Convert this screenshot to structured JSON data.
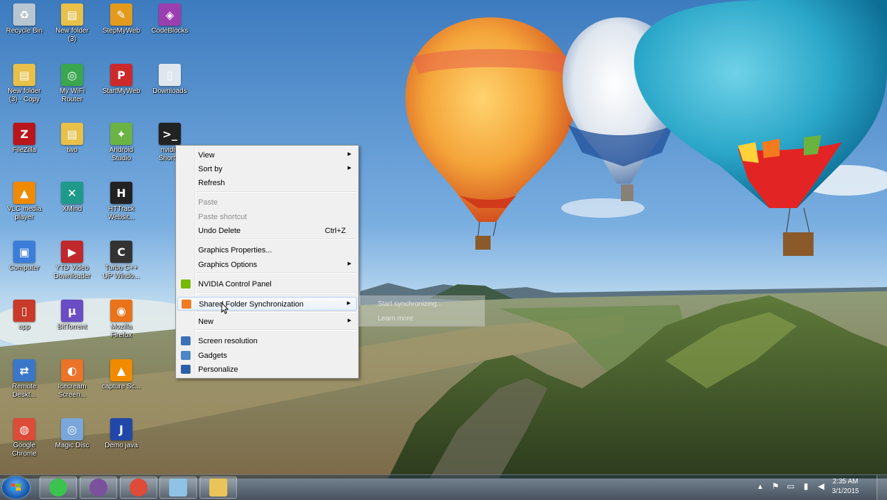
{
  "desktop": {
    "icons": [
      {
        "label": "Recycle Bin",
        "icon": "recycle-bin-icon",
        "color": "#b8c6d2"
      },
      {
        "label": "New folder\n(3)",
        "icon": "folder-icon",
        "color": "#e8c04a"
      },
      {
        "label": "StepMyWeb",
        "icon": "stepmyweb-icon",
        "color": "#e39b1e"
      },
      {
        "label": "CodeBlocks",
        "icon": "codeblocks-icon",
        "color": "#9b3fb0"
      },
      {
        "label": "New folder\n(3) - Copy",
        "icon": "folder-icon",
        "color": "#e8c04a"
      },
      {
        "label": "My WiFi\nRouter",
        "icon": "wifi-router-icon",
        "color": "#3aa650"
      },
      {
        "label": "StartMyWeb",
        "icon": "pinterest-icon",
        "color": "#cc2a2a"
      },
      {
        "label": "Downloads",
        "icon": "document-icon",
        "color": "#dfe6ee"
      },
      {
        "label": "FileZilla",
        "icon": "filezilla-icon",
        "color": "#b8161c"
      },
      {
        "label": "two",
        "icon": "folder-icon",
        "color": "#e8c04a"
      },
      {
        "label": "Android\nStudio",
        "icon": "android-studio-icon",
        "color": "#6ab344"
      },
      {
        "label": "nvidia\nShort...",
        "icon": "terminal-icon",
        "color": "#222222"
      },
      {
        "label": "VLC media\nplayer",
        "icon": "vlc-icon",
        "color": "#f08a00"
      },
      {
        "label": "XMind",
        "icon": "xmind-icon",
        "color": "#1f9a8a"
      },
      {
        "label": "HTTrack\nWebsit...",
        "icon": "httrack-icon",
        "color": "#222222"
      },
      {
        "label": "Computer",
        "icon": "computer-icon",
        "color": "#3b7dd8"
      },
      {
        "label": "YTD Video\nDownloader",
        "icon": "ytd-icon",
        "color": "#c0282d"
      },
      {
        "label": "Turbo C++\nUP Windo...",
        "icon": "turbo-cpp-icon",
        "color": "#333333"
      },
      {
        "label": "app",
        "icon": "document-icon",
        "color": "#c83a2a"
      },
      {
        "label": "BitTorrent",
        "icon": "bittorrent-icon",
        "color": "#6a4cc4"
      },
      {
        "label": "Mozilla\nFirefox",
        "icon": "firefox-icon",
        "color": "#e8731a"
      },
      {
        "label": "Remote\nDeskt...",
        "icon": "remote-desktop-icon",
        "color": "#3a77c9"
      },
      {
        "label": "Icecream\nScreen...",
        "icon": "icecream-icon",
        "color": "#e9742a"
      },
      {
        "label": "capture Sc...",
        "icon": "vlc-icon",
        "color": "#f08a00"
      },
      {
        "label": "Google\nChrome",
        "icon": "chrome-icon",
        "color": "#dd4b39"
      },
      {
        "label": "Magic Disc",
        "icon": "disc-icon",
        "color": "#7aa7d9"
      },
      {
        "label": "Demo java",
        "icon": "java-file-icon",
        "color": "#2148a8"
      }
    ]
  },
  "context_menu": {
    "items": [
      {
        "label": "View",
        "shortcut": "",
        "submenu": true,
        "disabled": false,
        "icon": ""
      },
      {
        "label": "Sort by",
        "shortcut": "",
        "submenu": true,
        "disabled": false,
        "icon": ""
      },
      {
        "label": "Refresh",
        "shortcut": "",
        "submenu": false,
        "disabled": false,
        "icon": ""
      },
      {
        "label": "Paste",
        "shortcut": "",
        "submenu": false,
        "disabled": true,
        "icon": ""
      },
      {
        "label": "Paste shortcut",
        "shortcut": "",
        "submenu": false,
        "disabled": true,
        "icon": ""
      },
      {
        "label": "Undo Delete",
        "shortcut": "Ctrl+Z",
        "submenu": false,
        "disabled": false,
        "icon": ""
      },
      {
        "label": "Graphics Properties...",
        "shortcut": "",
        "submenu": false,
        "disabled": false,
        "icon": ""
      },
      {
        "label": "Graphics Options",
        "shortcut": "",
        "submenu": true,
        "disabled": false,
        "icon": ""
      },
      {
        "label": "NVIDIA Control Panel",
        "shortcut": "",
        "submenu": false,
        "disabled": false,
        "icon": "nvidia-icon"
      },
      {
        "label": "Shared Folder Synchronization",
        "shortcut": "",
        "submenu": true,
        "disabled": false,
        "icon": "sync-icon",
        "highlighted": true
      },
      {
        "label": "New",
        "shortcut": "",
        "submenu": true,
        "disabled": false,
        "icon": ""
      },
      {
        "label": "Screen resolution",
        "shortcut": "",
        "submenu": false,
        "disabled": false,
        "icon": "screen-resolution-icon"
      },
      {
        "label": "Gadgets",
        "shortcut": "",
        "submenu": false,
        "disabled": false,
        "icon": "gadgets-icon"
      },
      {
        "label": "Personalize",
        "shortcut": "",
        "submenu": false,
        "disabled": false,
        "icon": "personalize-icon"
      }
    ],
    "submenu": {
      "items": [
        "Start synchronizing...",
        "Learn more"
      ]
    }
  },
  "taskbar": {
    "start_icon": "windows-start-icon",
    "pinned": [
      {
        "name": "whatsapp-icon",
        "color": "#3cc24e"
      },
      {
        "name": "viber-icon",
        "color": "#7b519d"
      },
      {
        "name": "chrome-icon",
        "color": "#dd4b39"
      },
      {
        "name": "notepad-icon",
        "color": "#8ec3e6"
      },
      {
        "name": "file-explorer-icon",
        "color": "#e8c45a"
      }
    ],
    "tray_icons": [
      "show-hidden-icons-icon",
      "action-center-flag-icon",
      "display-icon",
      "network-icon",
      "volume-icon"
    ],
    "clock": {
      "time": "2:35 AM",
      "date": "3/1/2015"
    }
  },
  "colors": {
    "menu_bg": "#f0f0f0",
    "menu_highlight_border": "#aecff7",
    "taskbar_bg": "#1e2d3d"
  }
}
